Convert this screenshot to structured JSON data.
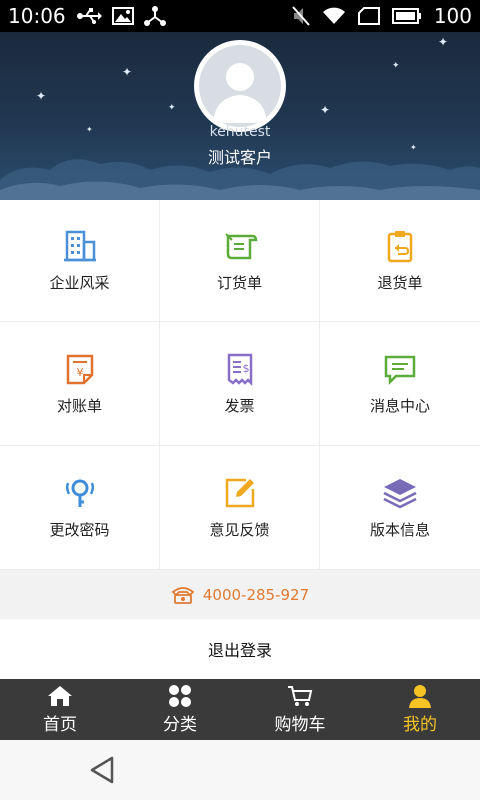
{
  "status_bar": {
    "time": "10:06",
    "battery_level": "100",
    "left_icons": [
      "usb-icon",
      "image-icon",
      "share-icon"
    ],
    "right_icons": [
      "mute-icon",
      "wifi-icon",
      "sim-icon",
      "battery-icon"
    ]
  },
  "profile": {
    "username": "kehutest",
    "display_name": "测试客户"
  },
  "menu": [
    {
      "label": "企业风采",
      "icon": "building-icon",
      "color": "#4a90d9"
    },
    {
      "label": "订货单",
      "icon": "order-scroll-icon",
      "color": "#5aab3a"
    },
    {
      "label": "退货单",
      "icon": "return-clipboard-icon",
      "color": "#f0a81e"
    },
    {
      "label": "对账单",
      "icon": "statement-icon",
      "color": "#e2702e"
    },
    {
      "label": "发票",
      "icon": "invoice-icon",
      "color": "#8a6fc9"
    },
    {
      "label": "消息中心",
      "icon": "message-icon",
      "color": "#5aab3a"
    },
    {
      "label": "更改密码",
      "icon": "key-icon",
      "color": "#3f8fd8"
    },
    {
      "label": "意见反馈",
      "icon": "feedback-edit-icon",
      "color": "#f0a81e"
    },
    {
      "label": "版本信息",
      "icon": "layers-icon",
      "color": "#7a6bb8"
    }
  ],
  "hotline": {
    "number": "4000-285-927",
    "icon": "phone-icon",
    "color": "#e07a32"
  },
  "logout": {
    "label": "退出登录"
  },
  "tabbar": {
    "items": [
      {
        "label": "首页",
        "icon": "home-icon"
      },
      {
        "label": "分类",
        "icon": "category-icon"
      },
      {
        "label": "购物车",
        "icon": "cart-icon"
      },
      {
        "label": "我的",
        "icon": "user-icon"
      }
    ],
    "active_index": 3,
    "active_color": "#f6c325"
  },
  "nav": {
    "back_icon": "back-triangle-icon"
  }
}
